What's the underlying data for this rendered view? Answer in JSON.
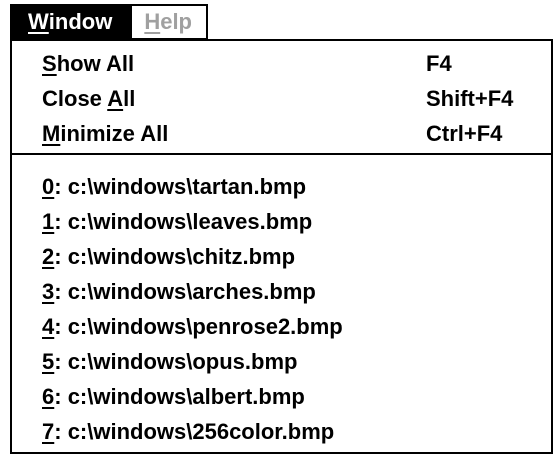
{
  "menubar": {
    "window": {
      "mnemonic": "W",
      "rest": "indow"
    },
    "help": {
      "mnemonic": "H",
      "rest": "elp"
    }
  },
  "menu": {
    "commands": [
      {
        "mnemonic": "S",
        "rest": "how All",
        "shortcut": "F4"
      },
      {
        "pre": "Close ",
        "mnemonic": "A",
        "rest": "ll",
        "shortcut": "Shift+F4"
      },
      {
        "mnemonic": "M",
        "rest": "inimize All",
        "shortcut": "Ctrl+F4"
      }
    ],
    "files": [
      {
        "mnemonic": "0",
        "rest": ": c:\\windows\\tartan.bmp"
      },
      {
        "mnemonic": "1",
        "rest": ": c:\\windows\\leaves.bmp"
      },
      {
        "mnemonic": "2",
        "rest": ": c:\\windows\\chitz.bmp"
      },
      {
        "mnemonic": "3",
        "rest": ": c:\\windows\\arches.bmp"
      },
      {
        "mnemonic": "4",
        "rest": ": c:\\windows\\penrose2.bmp"
      },
      {
        "mnemonic": "5",
        "rest": ": c:\\windows\\opus.bmp"
      },
      {
        "mnemonic": "6",
        "rest": ": c:\\windows\\albert.bmp"
      },
      {
        "mnemonic": "7",
        "rest": ": c:\\windows\\256color.bmp"
      }
    ]
  },
  "colors": {
    "highlight_bg": "#000000",
    "highlight_fg": "#ffffff",
    "disabled_fg": "#a0a0a0"
  }
}
